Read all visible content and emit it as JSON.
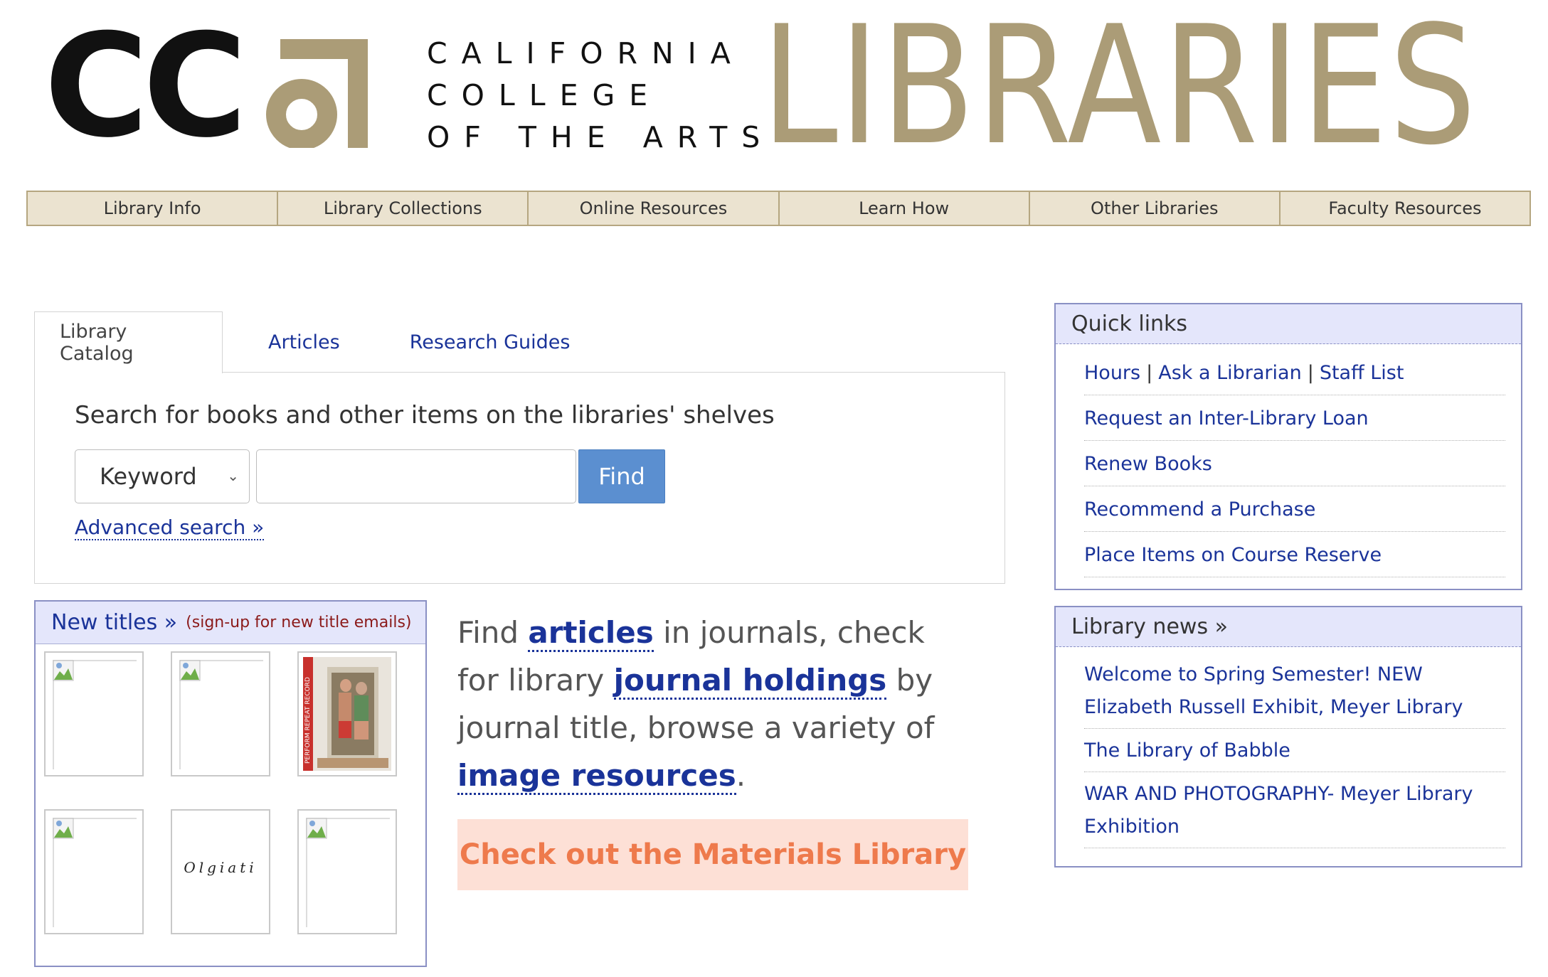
{
  "header": {
    "logo_letters": "CC",
    "college_lines": [
      "CALIFORNIA",
      "COLLEGE",
      "OF THE ARTS"
    ],
    "libraries": "LIBRARIES"
  },
  "nav": {
    "items": [
      "Library Info",
      "Library Collections",
      "Online Resources",
      "Learn How",
      "Other Libraries",
      "Faculty Resources"
    ]
  },
  "search": {
    "tabs": [
      "Library Catalog",
      "Articles",
      "Research Guides"
    ],
    "active_tab": "Library Catalog",
    "heading": "Search for books and other items on the libraries' shelves",
    "scope_selected": "Keyword",
    "query_value": "",
    "find_label": "Find",
    "advanced_label": "Advanced search »"
  },
  "new_titles": {
    "title": "New titles »",
    "signup": "(sign-up for new title emails)",
    "olgiati_text": "Olgiati",
    "cover_spine_text": "PERFORM REPEAT RECORD"
  },
  "blurb": {
    "p1": "Find ",
    "link1": "articles",
    "p2": " in journals, check for library ",
    "link2": "journal holdings",
    "p3": " by journal title, browse a variety of ",
    "link3": "image resources",
    "p4": "."
  },
  "materials_label": "Check out the Materials Library",
  "quick_links": {
    "title": "Quick links",
    "hours": "Hours",
    "ask": "Ask a Librarian",
    "staff": "Staff List",
    "sep": "|",
    "items": [
      "Request an Inter-Library Loan",
      "Renew Books",
      "Recommend a Purchase",
      "Place Items on Course Reserve"
    ]
  },
  "news": {
    "title": "Library news »",
    "items": [
      "Welcome to Spring Semester! NEW Elizabeth Russell Exhibit, Meyer Library",
      "The Library of Babble",
      "WAR AND PHOTOGRAPHY- Meyer Library Exhibition"
    ]
  },
  "colors": {
    "brand_gold": "#ab9c77",
    "link_blue": "#1a3399",
    "find_blue": "#5b8fd0",
    "materials_orange": "#ee7a4c"
  }
}
